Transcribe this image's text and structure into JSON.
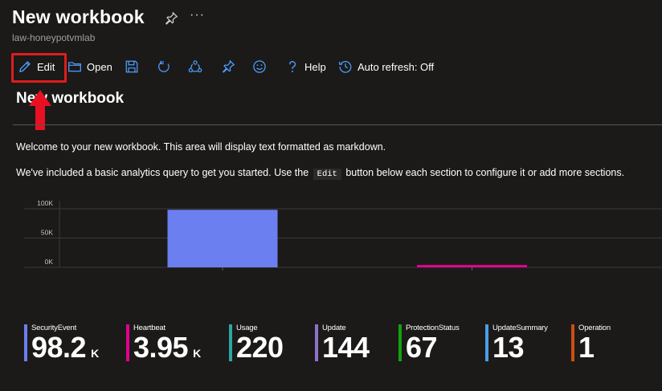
{
  "header": {
    "title": "New workbook",
    "more_label": "···",
    "subtitle": "law-honeypotvmlab"
  },
  "toolbar": {
    "edit_label": "Edit",
    "open_label": "Open",
    "help_label": "Help",
    "auto_refresh_label": "Auto refresh: Off"
  },
  "content": {
    "section_title": "New workbook",
    "para1": "Welcome to your new workbook. This area will display text formatted as markdown.",
    "para2_before": "We've included a basic analytics query to get you started. Use the",
    "para2_code": "Edit",
    "para2_after": "button below each section to configure it or add more sections."
  },
  "chart_data": {
    "type": "bar",
    "ylim": [
      0,
      100000
    ],
    "yticks": [
      0,
      50000,
      100000
    ],
    "ytick_labels": [
      "0K",
      "50K",
      "100K"
    ],
    "categories": [
      "SecurityEvent",
      "Heartbeat"
    ],
    "values": [
      98200,
      3950
    ],
    "colors": [
      "#6b7ff0",
      "#e3008c"
    ]
  },
  "tiles": [
    {
      "name": "SecurityEvent",
      "value": "98.2",
      "unit": "K",
      "color": "#6b7ff0"
    },
    {
      "name": "Heartbeat",
      "value": "3.95",
      "unit": "K",
      "color": "#e3008c"
    },
    {
      "name": "Usage",
      "value": "220",
      "unit": "",
      "color": "#2aa7a3"
    },
    {
      "name": "Update",
      "value": "144",
      "unit": "",
      "color": "#8e72c8"
    },
    {
      "name": "ProtectionStatus",
      "value": "67",
      "unit": "",
      "color": "#13a10e"
    },
    {
      "name": "UpdateSummary",
      "value": "13",
      "unit": "",
      "color": "#4a9ee6"
    },
    {
      "name": "Operation",
      "value": "1",
      "unit": "",
      "color": "#ca5010"
    }
  ],
  "accent": "#4ca0ff",
  "highlight": "#e01c1c"
}
